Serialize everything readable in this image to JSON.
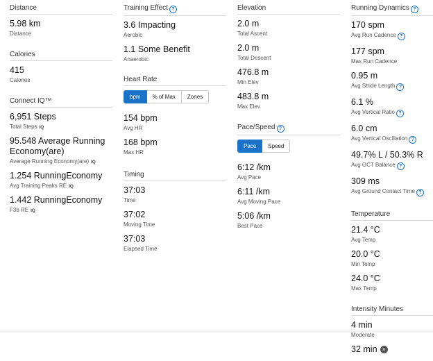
{
  "distance": {
    "title": "Distance",
    "value": "5.98 km",
    "label": "Distance"
  },
  "calories": {
    "title": "Calories",
    "value": "415",
    "label": "Calories"
  },
  "connect_iq": {
    "title": "Connect IQ™",
    "iq_badge": "IQ",
    "items": [
      {
        "value": "6,951 Steps",
        "label": "Total Steps"
      },
      {
        "value": "95.548 Average Running Economy(are)",
        "label": "Average Running Economy(are)"
      },
      {
        "value": "1.254 RunningEconomy",
        "label": "Avg Training Peaks RE"
      },
      {
        "value": "1.442 RunningEconomy",
        "label": "F3b RE"
      }
    ]
  },
  "training_effect": {
    "title": "Training Effect",
    "items": [
      {
        "value": "3.6 Impacting",
        "label": "Aerobic"
      },
      {
        "value": "1.1 Some Benefit",
        "label": "Anaerobic"
      }
    ]
  },
  "heart_rate": {
    "title": "Heart Rate",
    "tabs": [
      "bpm",
      "% of Max",
      "Zones"
    ],
    "items": [
      {
        "value": "154 bpm",
        "label": "Avg HR"
      },
      {
        "value": "168 bpm",
        "label": "Max HR"
      }
    ]
  },
  "timing": {
    "title": "Timing",
    "items": [
      {
        "value": "37:03",
        "label": "Time"
      },
      {
        "value": "37:02",
        "label": "Moving Time"
      },
      {
        "value": "37:03",
        "label": "Elapsed Time"
      }
    ]
  },
  "elevation": {
    "title": "Elevation",
    "items": [
      {
        "value": "2.0 m",
        "label": "Total Ascent"
      },
      {
        "value": "2.0 m",
        "label": "Total Descent"
      },
      {
        "value": "476.8 m",
        "label": "Min Elev"
      },
      {
        "value": "483.8 m",
        "label": "Max Elev"
      }
    ]
  },
  "pace_speed": {
    "title": "Pace/Speed",
    "tabs": [
      "Pace",
      "Speed"
    ],
    "items": [
      {
        "value": "6:12 /km",
        "label": "Avg Pace"
      },
      {
        "value": "6:11 /km",
        "label": "Avg Moving Pace"
      },
      {
        "value": "5:06 /km",
        "label": "Best Pace"
      }
    ]
  },
  "running_dynamics": {
    "title": "Running Dynamics",
    "items": [
      {
        "value": "170 spm",
        "label": "Avg Run Cadence"
      },
      {
        "value": "177 spm",
        "label": "Max Run Cadence"
      },
      {
        "value": "0.95 m",
        "label": "Avg Stride Length"
      },
      {
        "value": "6.1 %",
        "label": "Avg Vertical Ratio"
      },
      {
        "value": "6.0 cm",
        "label": "Avg Vertical Oscillation"
      },
      {
        "value": "49.7% L / 50.3% R",
        "label": "Avg GCT Balance"
      },
      {
        "value": "309 ms",
        "label": "Avg Ground Contact Time"
      }
    ]
  },
  "temperature": {
    "title": "Temperature",
    "items": [
      {
        "value": "21.4 °C",
        "label": "Avg Temp"
      },
      {
        "value": "20.0 °C",
        "label": "Min Temp"
      },
      {
        "value": "24.0 °C",
        "label": "Max Temp"
      }
    ]
  },
  "intensity_minutes": {
    "title": "Intensity Minutes",
    "items": [
      {
        "value": "4 min",
        "label": "Moderate"
      },
      {
        "value": "32 min",
        "label": ""
      }
    ]
  },
  "colors": {
    "accent": "#1a73c9",
    "divider": "#d8d8d8"
  },
  "icons": {
    "help": "help-circle-icon",
    "iq": "connect-iq-icon"
  }
}
